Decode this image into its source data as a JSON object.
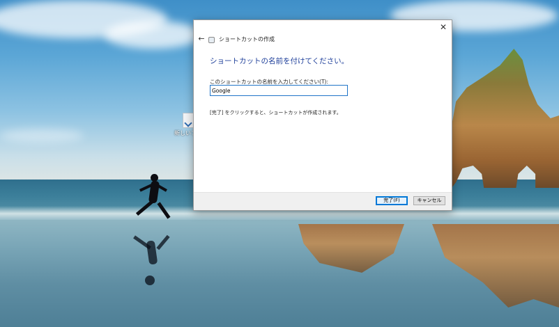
{
  "desktop": {
    "icon_label": "新しいフ"
  },
  "dialog": {
    "window_title": "ショートカットの作成",
    "heading": "ショートカットの名前を付けてください。",
    "field_label": "このショートカットの名前を入力してください(T):",
    "field_value": "Google",
    "info_text": "[完了] をクリックすると、ショートカットが作成されます。",
    "back_symbol": "←",
    "close_symbol": "✕",
    "finish_label": "完了(F)",
    "cancel_label": "キャンセル"
  },
  "colors": {
    "heading": "#1e3f9a",
    "input_border": "#1f74c8",
    "default_button_border": "#0078d7"
  }
}
